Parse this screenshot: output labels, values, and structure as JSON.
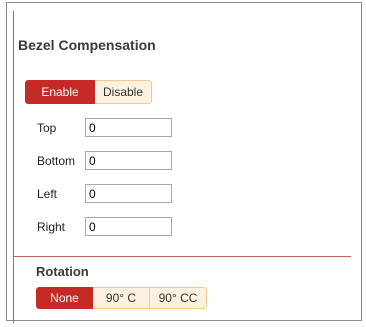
{
  "bezel": {
    "title": "Bezel Compensation",
    "enable_label": "Enable",
    "disable_label": "Disable",
    "active": "Enable",
    "fields": {
      "top": {
        "label": "Top",
        "value": "0"
      },
      "bottom": {
        "label": "Bottom",
        "value": "0"
      },
      "left": {
        "label": "Left",
        "value": "0"
      },
      "right": {
        "label": "Right",
        "value": "0"
      }
    }
  },
  "rotation": {
    "title": "Rotation",
    "none_label": "None",
    "cw_label": "90° C",
    "ccw_label": "90° CC",
    "active": "None"
  },
  "colors": {
    "active_button": "#c62a27",
    "inactive_button": "#fdf2df",
    "inactive_border": "#f5c788",
    "accent_line": "#c4605a"
  }
}
